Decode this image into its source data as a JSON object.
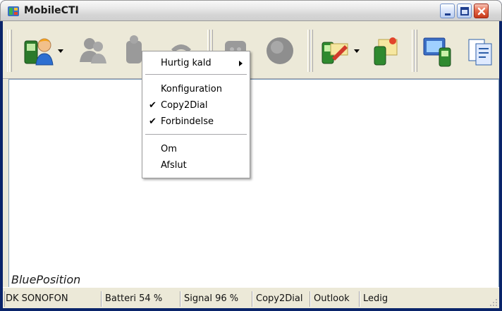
{
  "window": {
    "title": "MobileCTI",
    "app_icon": "mobilecti-app-icon",
    "buttons": {
      "minimize": "minimize-icon",
      "maximize": "maximize-icon",
      "close": "close-icon"
    }
  },
  "toolbar": {
    "buttons": [
      {
        "name": "contact-person-icon",
        "enabled": true,
        "has_dropdown": true
      },
      {
        "name": "contacts-group-icon",
        "enabled": false,
        "has_dropdown": false
      },
      {
        "name": "call-icon",
        "enabled": false,
        "has_dropdown": false
      },
      {
        "name": "phone-handset-icon",
        "enabled": false,
        "has_dropdown": false
      },
      {
        "name": "sms-icon",
        "enabled": false,
        "has_dropdown": false
      },
      {
        "name": "record-icon",
        "enabled": false,
        "has_dropdown": false
      },
      {
        "name": "phone-edit-icon",
        "enabled": true,
        "has_dropdown": true
      },
      {
        "name": "phone-notes-icon",
        "enabled": true,
        "has_dropdown": false
      },
      {
        "name": "sync-devices-icon",
        "enabled": true,
        "has_dropdown": false
      },
      {
        "name": "copy-documents-icon",
        "enabled": true,
        "has_dropdown": false
      }
    ]
  },
  "context_menu": {
    "items": [
      {
        "label": "Hurtig kald",
        "checked": false,
        "submenu": true
      },
      {
        "label": "Konfiguration",
        "checked": false,
        "submenu": false
      },
      {
        "label": "Copy2Dial",
        "checked": true,
        "submenu": false
      },
      {
        "label": "Forbindelse",
        "checked": true,
        "submenu": false
      },
      {
        "label": "Om",
        "checked": false,
        "submenu": false
      },
      {
        "label": "Afslut",
        "checked": false,
        "submenu": false
      }
    ],
    "check_glyph": "✔"
  },
  "content": {
    "brand": "BluePosition"
  },
  "statusbar": {
    "operator": "DK SONOFON",
    "battery": "Batteri 54 %",
    "signal": "Signal 96 %",
    "copy2dial": "Copy2Dial",
    "outlook": "Outlook",
    "state": "Ledig"
  },
  "colors": {
    "frame": "#ece9d8",
    "menu_bg": "#ffffff",
    "content_border": "#7f9db9",
    "close_red": "#c53a1a"
  }
}
